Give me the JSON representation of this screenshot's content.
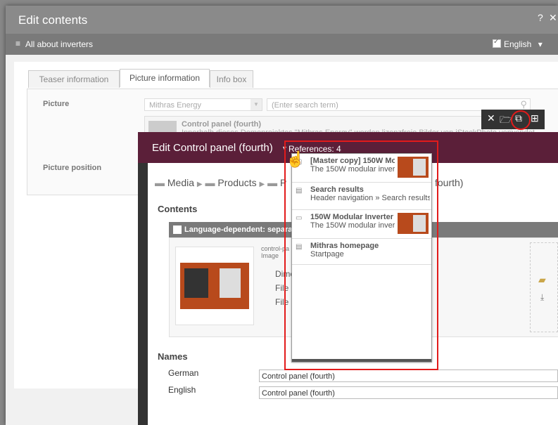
{
  "window": {
    "title": "Edit contents",
    "help_icon": "?",
    "close_icon": "✕"
  },
  "subbar": {
    "menu_icon": "≡",
    "node_name": "All about inverters",
    "language": "English",
    "dropdown_icon": "▾"
  },
  "tabs": [
    {
      "label": "Teaser information",
      "active": false
    },
    {
      "label": "Picture information",
      "active": true
    },
    {
      "label": "Info box",
      "active": false
    }
  ],
  "form": {
    "picture_label": "Picture",
    "project_select": "Mithras Energy",
    "search_placeholder": "(Enter search term)",
    "picture_position_label": "Picture position",
    "selected_picture": {
      "title": "Control panel (fourth)",
      "description": "Innerhalb dieses Demoprojektes \"Mithras Energy\" werden lizenzfreie Bilder von iStockPhoto verwendet"
    }
  },
  "toolbar": {
    "remove_icon": "✕",
    "open_icon": "🗁",
    "show_refs_icon": "⧉",
    "new_icon": "⊞"
  },
  "editor": {
    "title": "Edit Control panel (fourth)",
    "references_label": "References: 4",
    "breadcrumb": {
      "media": "Media",
      "products": "Products",
      "partial": "P",
      "trailing": "fourth)"
    },
    "contents_heading": "Contents",
    "language_dependent": "Language-dependent: separate",
    "file_name": "control-pa",
    "file_type": "Image",
    "dims_label": "Dime",
    "file_label1": "File",
    "file_label2": "File",
    "names_heading": "Names",
    "names": [
      {
        "language": "German",
        "value": "Control panel (fourth)"
      },
      {
        "language": "English",
        "value": "Control panel (fourth)"
      }
    ]
  },
  "references": [
    {
      "icon": "page-icon",
      "title": "[Master copy] 150W Mo",
      "subtitle": "The 150W modular inver",
      "has_thumb": true
    },
    {
      "icon": "page-icon",
      "title": "Search results",
      "subtitle": "Header navigation » Search results",
      "has_thumb": false
    },
    {
      "icon": "dataset-icon",
      "title": "150W Modular Inverter",
      "subtitle": "The 150W modular inver",
      "has_thumb": true
    },
    {
      "icon": "page-icon",
      "title": "Mithras homepage",
      "subtitle": "Startpage",
      "has_thumb": false
    }
  ],
  "colors": {
    "editor_title_bg": "#5b1f39",
    "highlight_red": "#e21b1b",
    "window_title_bg": "#8a8a8a"
  }
}
